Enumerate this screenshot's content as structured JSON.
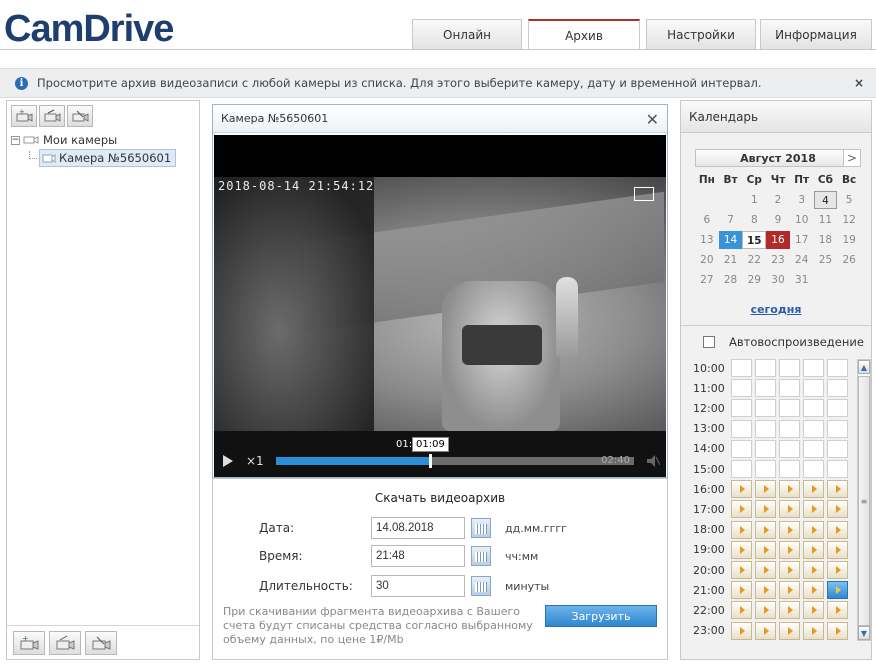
{
  "brand": {
    "logo": "CamDrive"
  },
  "tabs": [
    {
      "label": "Онлайн",
      "active": false
    },
    {
      "label": "Архив",
      "active": true
    },
    {
      "label": "Настройки",
      "active": false
    },
    {
      "label": "Информация",
      "active": false
    }
  ],
  "info": {
    "text": "Просмотрите архив видеозаписи с любой камеры из списка. Для этого выберите камеру, дату и временной интервал.",
    "close": "×"
  },
  "tree": {
    "root": "Мои камеры",
    "camera": "Камера №5650601"
  },
  "player": {
    "title": "Камера №5650601",
    "osd": "2018-08-14 21:54:12",
    "speed": "×1",
    "current": "01:09",
    "current_hidden": "01:",
    "duration": "02:40",
    "progress": 0.43
  },
  "download": {
    "title": "Скачать видеоархив",
    "date_label": "Дата:",
    "date_value": "14.08.2018",
    "date_hint": "дд.мм.гггг",
    "time_label": "Время:",
    "time_value": "21:48",
    "time_hint": "чч:мм",
    "dur_label": "Длительность:",
    "dur_value": "30",
    "dur_hint": "минуты",
    "note": "При скачивании фрагмента видеоархива с Вашего счета будут списаны средства согласно выбранному объему данных, по цене 1₽/Mb",
    "button": "Загрузить"
  },
  "calendar": {
    "header": "Календарь",
    "month": "Август 2018",
    "prev": "<",
    "next": ">",
    "weekdays": [
      "Пн",
      "Вт",
      "Ср",
      "Чт",
      "Пт",
      "Сб",
      "Вс"
    ],
    "days": [
      "",
      "",
      "1",
      "2",
      "3",
      "4",
      "5",
      "6",
      "7",
      "8",
      "9",
      "10",
      "11",
      "12",
      "13",
      "14",
      "15",
      "16",
      "17",
      "18",
      "19",
      "20",
      "21",
      "22",
      "23",
      "24",
      "25",
      "26",
      "27",
      "28",
      "29",
      "30",
      "31",
      "",
      ""
    ],
    "today_link": "сегодня",
    "autoplay": "Автовоспроизведение"
  },
  "timeline": {
    "hours": [
      "10:00",
      "11:00",
      "12:00",
      "13:00",
      "14:00",
      "15:00",
      "16:00",
      "17:00",
      "18:00",
      "19:00",
      "20:00",
      "21:00",
      "22:00",
      "23:00"
    ],
    "recorded_from_hour_index": 6,
    "current_hour_index": 11,
    "current_slot": 4
  },
  "colors": {
    "accent": "#2a8fd6",
    "brand": "#1d3e6e",
    "active_tab": "#b03030",
    "today_day": "#b32a2a"
  }
}
